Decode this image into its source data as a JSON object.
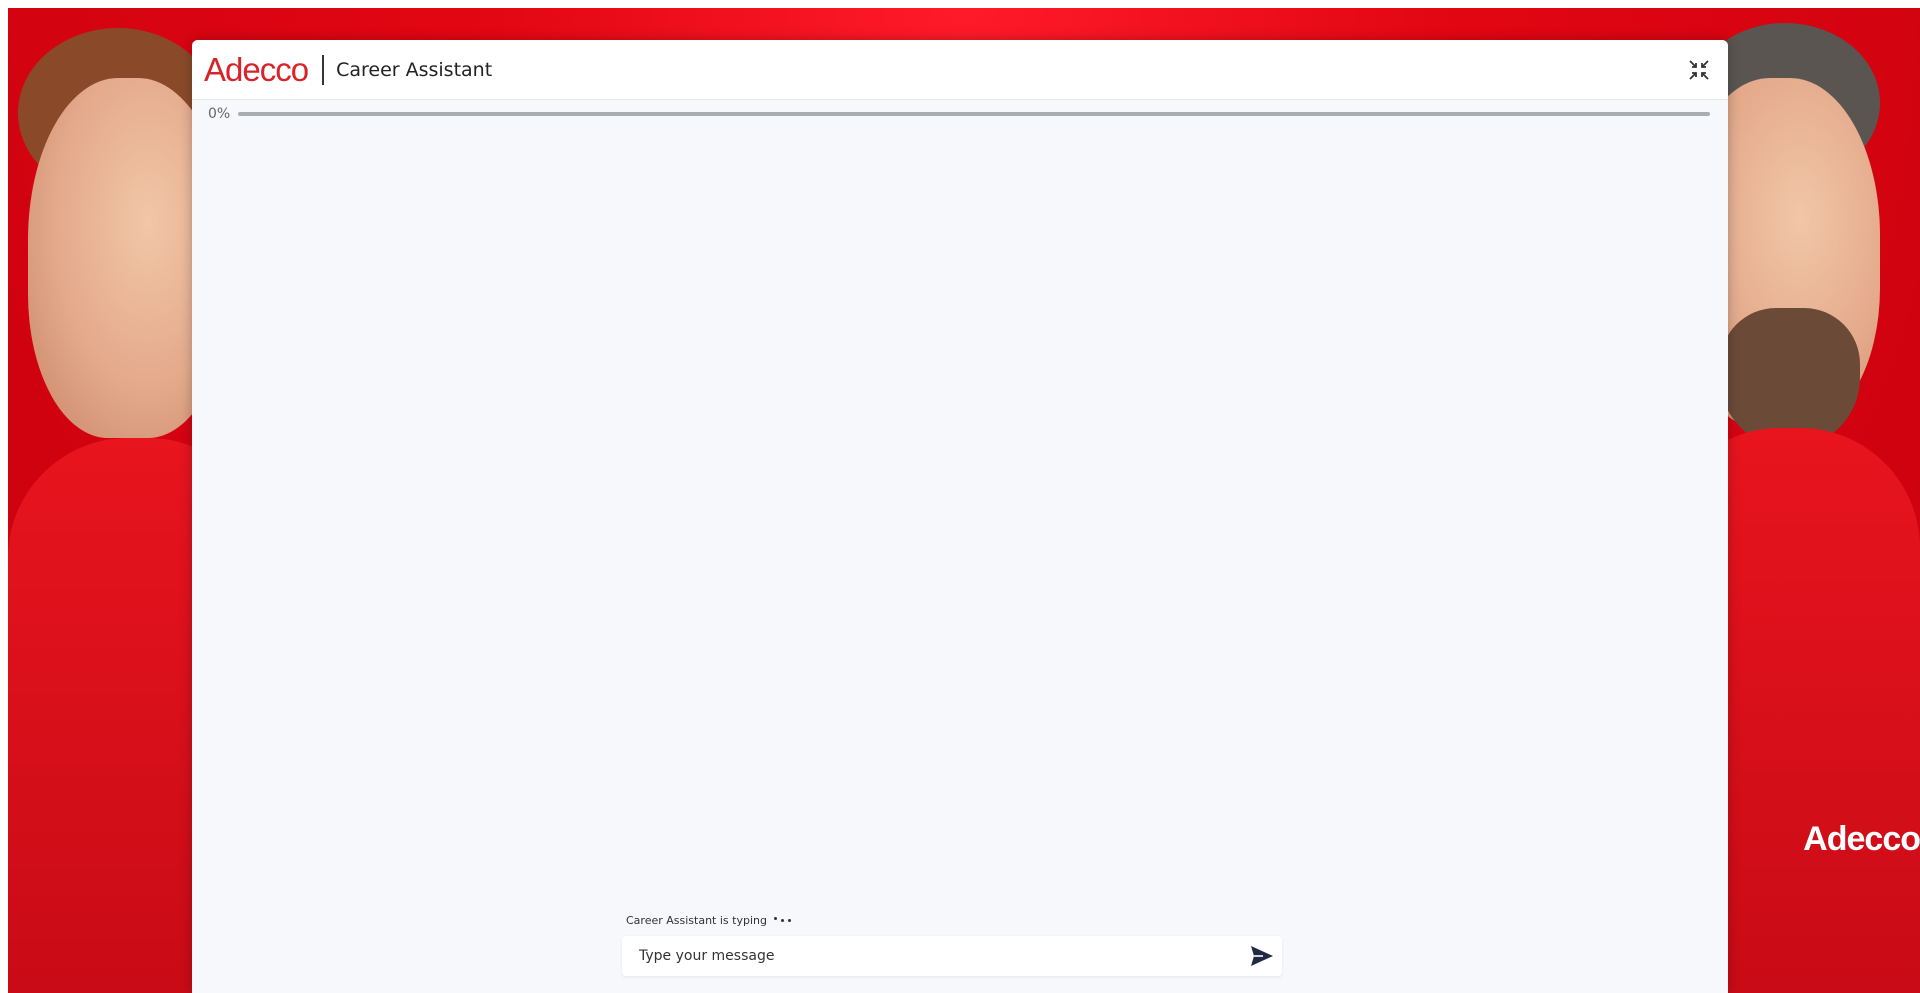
{
  "header": {
    "brand": "Adecco",
    "title": "Career Assistant",
    "minimize_icon": "minimize-icon"
  },
  "progress": {
    "label": "0%",
    "value": 0
  },
  "chat": {
    "typing_text": "Career Assistant is typing"
  },
  "composer": {
    "placeholder": "Type your message",
    "send_icon": "send-icon"
  },
  "background": {
    "logo_text": "Adecco"
  },
  "colors": {
    "brand_red": "#d8232a",
    "background_red": "#e30613"
  }
}
